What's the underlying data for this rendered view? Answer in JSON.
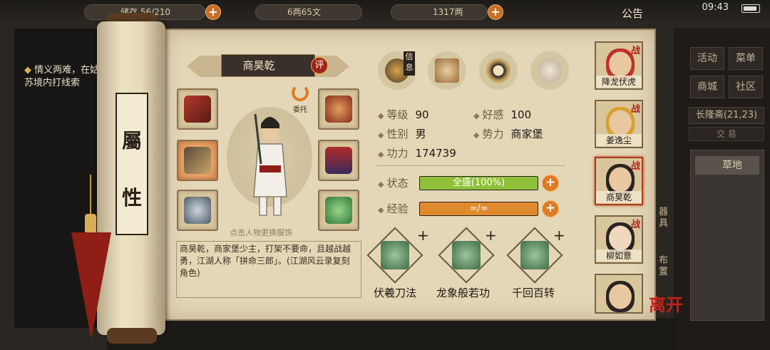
{
  "top_bar": {
    "res1_text": "储存  56/210",
    "res2_text": "6两65文",
    "res3_text": "1317两",
    "announcement": "公告",
    "clock": "09:43"
  },
  "quest": {
    "text": "情义两难，在姑苏境内打线索"
  },
  "right_menu": {
    "activity": "活动",
    "menu": "菜单",
    "shop": "商城",
    "community": "社区",
    "location": "长隆斋(21,23)",
    "sub": "交 易",
    "terrain": "草地"
  },
  "side_labels": {
    "equip": "器具",
    "layout": "布置"
  },
  "attr_tab": {
    "c1": "屬",
    "c2": "性"
  },
  "character": {
    "name": "商昊乾",
    "rate_badge": "评",
    "entrust": "委托",
    "hint": "点击人物更换服饰",
    "description": "商昊乾，商家堡少主，打架不要命，且越战越勇，江湖人称「拼命三郎」。(江湖风云录复刻角色)"
  },
  "info_tab_label": "信息",
  "stats": {
    "level_label": "等级",
    "level": "90",
    "favor_label": "好感",
    "favor": "100",
    "gender_label": "性别",
    "gender": "男",
    "faction_label": "势力",
    "faction": "商家堡",
    "power_label": "功力",
    "power": "174739"
  },
  "status": {
    "label": "状态",
    "text": "全盛(100%)",
    "fill": 1.0,
    "color": "#8fc03a"
  },
  "experience": {
    "label": "经验",
    "text": "∞/∞",
    "fill": 1.0,
    "color": "#e08a2e"
  },
  "skills": [
    {
      "name": "伏羲刀法",
      "plus": "+"
    },
    {
      "name": "龙象般若功",
      "plus": "+"
    },
    {
      "name": "千回百转",
      "plus": "+"
    }
  ],
  "roster": [
    {
      "name": "降龙伏虎",
      "tag": "战"
    },
    {
      "name": "姜逸尘",
      "tag": "战"
    },
    {
      "name": "商昊乾",
      "tag": "战"
    },
    {
      "name": "柳如意",
      "tag": "战"
    },
    {
      "name": "",
      "tag": ""
    }
  ],
  "leave_label": "离开"
}
